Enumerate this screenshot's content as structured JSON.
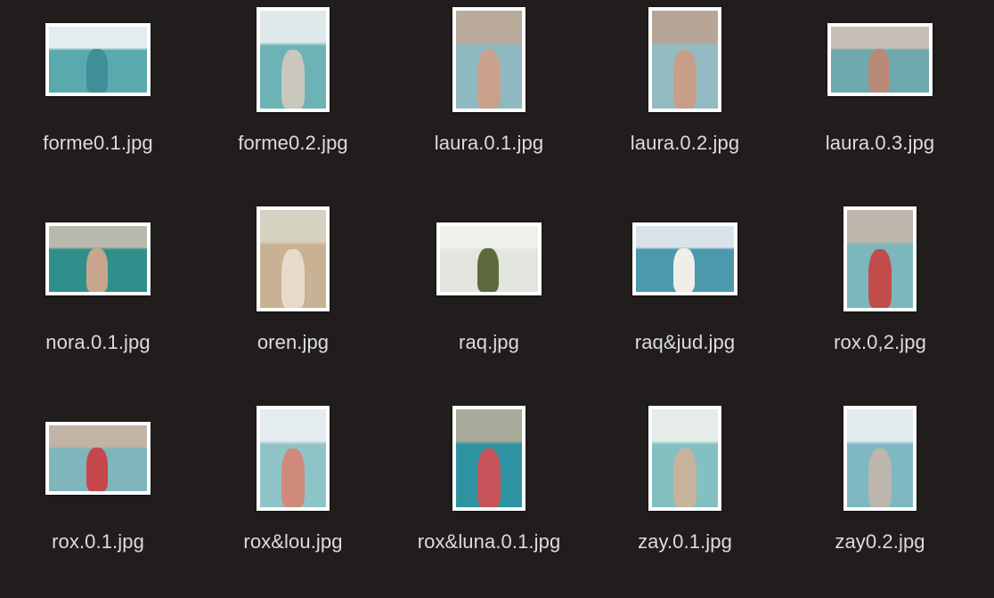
{
  "files": [
    {
      "name": "forme0.1.jpg",
      "orientation": "landscape",
      "colors": [
        "#e3ecee",
        "#5aa9ad",
        "#3f8f98"
      ]
    },
    {
      "name": "forme0.2.jpg",
      "orientation": "portrait",
      "colors": [
        "#dfe9ea",
        "#6db3b6",
        "#c9c7be"
      ]
    },
    {
      "name": "laura.0.1.jpg",
      "orientation": "portrait",
      "colors": [
        "#b9aa9c",
        "#8fb9c0",
        "#c9a18c"
      ]
    },
    {
      "name": "laura.0.2.jpg",
      "orientation": "portrait",
      "colors": [
        "#b7a698",
        "#93bcc2",
        "#c79f88"
      ]
    },
    {
      "name": "laura.0.3.jpg",
      "orientation": "landscape",
      "colors": [
        "#c8c0b6",
        "#6fa8ad",
        "#b98a78"
      ]
    },
    {
      "name": "nora.0.1.jpg",
      "orientation": "landscape",
      "colors": [
        "#b8b9ac",
        "#2f8f8a",
        "#c9a58e"
      ]
    },
    {
      "name": "oren.jpg",
      "orientation": "portrait",
      "colors": [
        "#d6d2c2",
        "#c9b193",
        "#e6dbcb"
      ]
    },
    {
      "name": "raq.jpg",
      "orientation": "landscape",
      "colors": [
        "#eef0ea",
        "#e3e5df",
        "#5d6a3e"
      ]
    },
    {
      "name": "raq&jud.jpg",
      "orientation": "landscape",
      "colors": [
        "#d9e4ea",
        "#4c98ad",
        "#f0eee9"
      ]
    },
    {
      "name": "rox.0,2.jpg",
      "orientation": "portrait",
      "colors": [
        "#bfb5aa",
        "#7cb7be",
        "#c24b4b"
      ]
    },
    {
      "name": "rox.0.1.jpg",
      "orientation": "landscape",
      "colors": [
        "#c2b4a5",
        "#7fb6bb",
        "#c7474c"
      ]
    },
    {
      "name": "rox&lou.jpg",
      "orientation": "portrait",
      "colors": [
        "#e4ecef",
        "#8ec4c8",
        "#cf8a7b"
      ]
    },
    {
      "name": "rox&luna.0.1.jpg",
      "orientation": "portrait",
      "colors": [
        "#a8ab9a",
        "#2e93a1",
        "#c9535a"
      ]
    },
    {
      "name": "zay.0.1.jpg",
      "orientation": "portrait",
      "colors": [
        "#e5ecea",
        "#84bfc1",
        "#c7b39c"
      ]
    },
    {
      "name": "zay0.2.jpg",
      "orientation": "portrait",
      "colors": [
        "#e3ebee",
        "#7fb8c1",
        "#bcb6ad"
      ]
    }
  ]
}
